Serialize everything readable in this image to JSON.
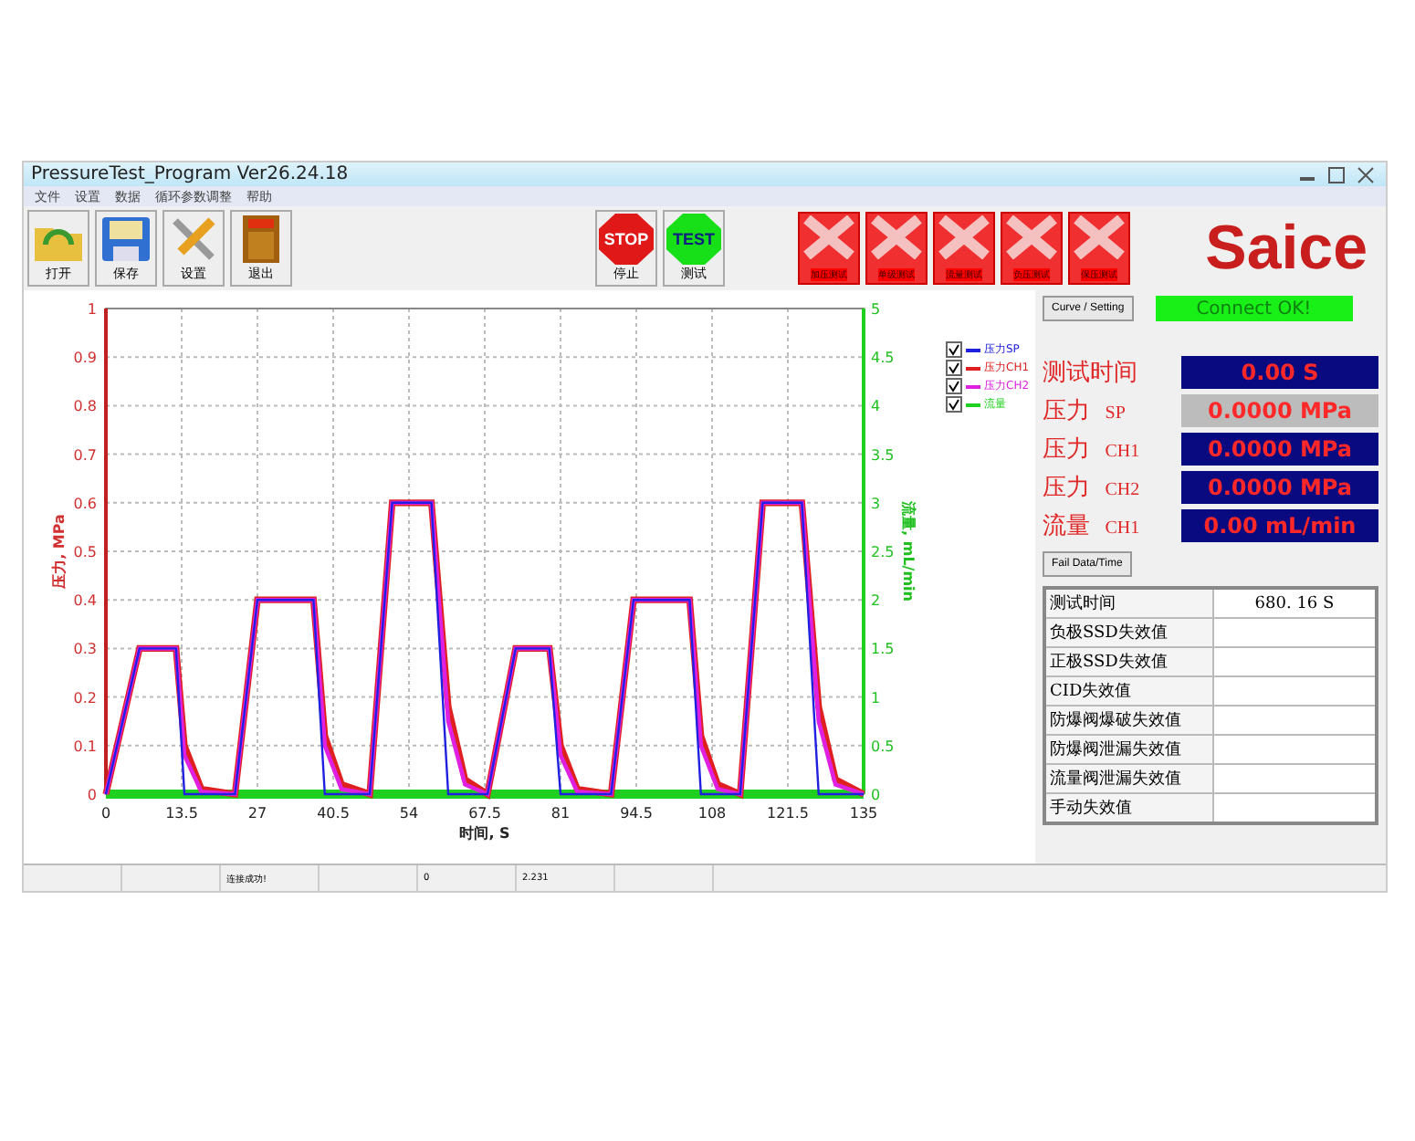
{
  "window": {
    "title": "PressureTest_Program  Ver26.24.18"
  },
  "menu": [
    "文件",
    "设置",
    "数据",
    "循环参数调整",
    "帮助"
  ],
  "toolbar": [
    {
      "kind": "open",
      "label": "打开"
    },
    {
      "kind": "save",
      "label": "保存"
    },
    {
      "kind": "settings",
      "label": "设置"
    },
    {
      "kind": "exit",
      "label": "退出"
    }
  ],
  "controls": [
    {
      "kind": "stop",
      "sign": "STOP",
      "label": "停止"
    },
    {
      "kind": "test",
      "sign": "TEST",
      "label": "测试"
    }
  ],
  "test_buttons": [
    "加压测试",
    "单级测试",
    "流量测试",
    "负压测试",
    "保压测试"
  ],
  "logo": "Saice",
  "chart": {
    "y2_label": "流量, mL/min",
    "y2_ticks": [
      "5",
      "4.5",
      "4",
      "3.5",
      "3",
      "2.5",
      "2",
      "1.5",
      "1",
      "0.5",
      "0"
    ],
    "legend": [
      {
        "checked": true
      },
      {
        "checked": true
      },
      {
        "checked": true
      },
      {
        "checked": true
      }
    ],
    "chart_data": {
      "type": "line",
      "grid": true,
      "xlabel": "时间, S",
      "ylabel": "压力, MPa",
      "xlim": [
        0,
        135
      ],
      "ylim": [
        0,
        1
      ],
      "xticks": [
        0,
        13.5,
        27,
        40.5,
        54,
        67.5,
        81,
        94.5,
        108,
        121.5,
        135
      ],
      "yticks": [
        0,
        0.1,
        0.2,
        0.3,
        0.4,
        0.5,
        0.6,
        0.7,
        0.8,
        0.9,
        1
      ],
      "x": [
        0,
        6,
        12.5,
        14,
        17,
        23,
        27,
        37,
        39,
        42,
        47,
        51,
        58,
        61,
        64,
        68,
        73,
        79,
        81,
        84,
        90,
        94,
        104,
        106,
        109,
        113,
        117,
        124,
        127,
        130,
        135
      ],
      "series": [
        {
          "name": "压力SP",
          "color": "#2020e0",
          "values": [
            0,
            0.3,
            0.3,
            0,
            0,
            0,
            0.4,
            0.4,
            0,
            0,
            0,
            0.6,
            0.6,
            0,
            0,
            0,
            0.3,
            0.3,
            0,
            0,
            0,
            0.4,
            0.4,
            0,
            0,
            0,
            0.6,
            0.6,
            0,
            0,
            0
          ]
        },
        {
          "name": "压力CH1",
          "color": "#e02020",
          "values": [
            0,
            0.3,
            0.3,
            0.1,
            0.01,
            0,
            0.4,
            0.4,
            0.12,
            0.02,
            0,
            0.6,
            0.6,
            0.18,
            0.03,
            0,
            0.3,
            0.3,
            0.1,
            0.01,
            0,
            0.4,
            0.4,
            0.12,
            0.02,
            0,
            0.6,
            0.6,
            0.18,
            0.03,
            0
          ]
        },
        {
          "name": "压力CH2",
          "color": "#e020e0",
          "values": [
            0,
            0.3,
            0.3,
            0.08,
            0.005,
            0,
            0.4,
            0.4,
            0.1,
            0.01,
            0,
            0.6,
            0.6,
            0.15,
            0.02,
            0,
            0.3,
            0.3,
            0.08,
            0.005,
            0,
            0.4,
            0.4,
            0.1,
            0.01,
            0,
            0.6,
            0.6,
            0.15,
            0.02,
            0
          ]
        },
        {
          "name": "流量",
          "color": "#20d020",
          "values": [
            0,
            0,
            0,
            0,
            0,
            0,
            0,
            0,
            0,
            0,
            0,
            0,
            0,
            0,
            0,
            0,
            0,
            0,
            0,
            0,
            0,
            0,
            0,
            0,
            0,
            0,
            0,
            0,
            0,
            0,
            0
          ]
        }
      ]
    }
  },
  "curve_button": "Curve / Setting",
  "connection": "Connect OK!",
  "readings": [
    {
      "label": "测试时间",
      "value": "0.00 S",
      "active": true
    },
    {
      "label": "压力",
      "channel": "SP",
      "value": "0.0000 MPa",
      "active": false
    },
    {
      "label": "压力",
      "channel": "CH1",
      "value": "0.0000 MPa",
      "active": true
    },
    {
      "label": "压力",
      "channel": "CH2",
      "value": "0.0000 MPa",
      "active": true
    },
    {
      "label": "流量",
      "channel": "CH1",
      "value": "0.00 mL/min",
      "active": true
    }
  ],
  "fail_button": "Fail Data/Time",
  "results": [
    {
      "label": "测试时间",
      "value": "680. 16  S"
    },
    {
      "label": "负极SSD失效值"
    },
    {
      "label": "正极SSD失效值"
    },
    {
      "label": "CID失效值"
    },
    {
      "label": "防爆阀爆破失效值"
    },
    {
      "label": "防爆阀泄漏失效值"
    },
    {
      "label": "流量阀泄漏失效值"
    },
    {
      "label": "手动失效值"
    }
  ],
  "status_bar": [
    "连接成功!",
    "0",
    "2.231"
  ]
}
